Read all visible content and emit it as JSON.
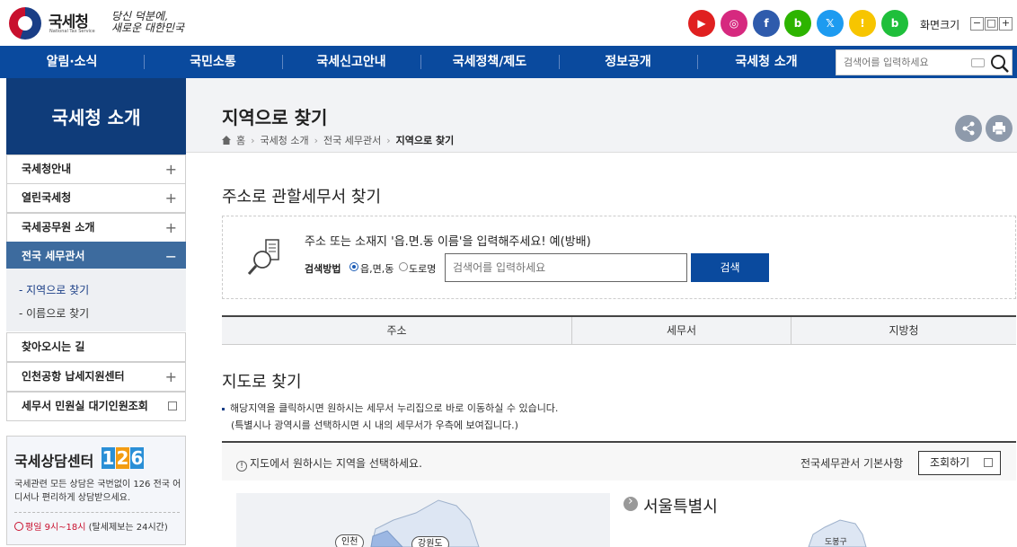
{
  "header": {
    "brand": "국세청",
    "brand_sub": "National Tax Service",
    "slogan_line1": "당신 덕분에,",
    "slogan_line2": "새로운 대한민국",
    "sns": [
      {
        "name": "youtube-icon",
        "glyph": "▶",
        "color": "#e02020"
      },
      {
        "name": "instagram-icon",
        "glyph": "◎",
        "color": "#d6297f"
      },
      {
        "name": "facebook-icon",
        "glyph": "f",
        "color": "#2f5bac"
      },
      {
        "name": "blog-icon",
        "glyph": "b",
        "color": "#2db400"
      },
      {
        "name": "x-icon",
        "glyph": "𝕏",
        "color": "#1d9bf0"
      },
      {
        "name": "kakao-story-icon",
        "glyph": "!",
        "color": "#f7c500"
      },
      {
        "name": "band-icon",
        "glyph": "b",
        "color": "#1fbf3b"
      }
    ],
    "font_size_label": "화면크기",
    "font_size_buttons": [
      "−",
      "□",
      "+"
    ]
  },
  "gnb": {
    "items": [
      "알림·소식",
      "국민소통",
      "국세신고안내",
      "국세정책/제도",
      "정보공개",
      "국세청 소개"
    ],
    "search_placeholder": "검색어를 입력하세요"
  },
  "sidebar": {
    "title": "국세청 소개",
    "items": [
      {
        "label": "국세청안내",
        "icon": "+"
      },
      {
        "label": "열린국세청",
        "icon": "+"
      },
      {
        "label": "국세공무원 소개",
        "icon": "+"
      },
      {
        "label": "전국 세무관서",
        "icon": "−"
      },
      {
        "label": "찾아오시는 길",
        "icon": ""
      },
      {
        "label": "인천공항 납세지원센터",
        "icon": "+"
      },
      {
        "label": "세무서 민원실 대기인원조회",
        "icon": "ext"
      }
    ],
    "sub_items": [
      "- 지역으로 찾기",
      "- 이름으로 찾기"
    ],
    "consult": {
      "title": "국세상담센터",
      "number": [
        "1",
        "2",
        "6"
      ],
      "desc": "국세관련 모든 상담은 국번없이 126 전국 어디서나 편리하게 상담받으세요.",
      "time_red": "평일 9시~18시",
      "time_rest": "(탈세제보는 24시간)"
    }
  },
  "main": {
    "title": "지역으로 찾기",
    "breadcrumb": [
      "홈",
      "국세청 소개",
      "전국 세무관서",
      "지역으로 찾기"
    ],
    "address_section": {
      "title": "주소로 관할세무서 찾기",
      "message": "주소 또는 소재지 '읍.면.동 이름'을 입력해주세요! 예(방배)",
      "method_label": "검색방법",
      "options": [
        "읍,면,동",
        "도로명"
      ],
      "input_placeholder": "검색어를 입력하세요",
      "search_button": "검색"
    },
    "result_headers": [
      "주소",
      "세무서",
      "지방청"
    ],
    "map_section": {
      "title": "지도로 찾기",
      "desc1": "해당지역을 클릭하시면 원하시는 세무서 누리집으로 바로 이동하실 수 있습니다.",
      "desc2": "(특별시나 광역시를 선택하시면 시 내의 세무서가 우측에 보여집니다.)",
      "bar_message": "지도에서 원하시는 지역을 선택하세요.",
      "basic_label": "전국세무관서 기본사항",
      "view_button": "조회하기",
      "map_labels": [
        "인천",
        "강원도"
      ],
      "region_title": "서울특별시",
      "gu_label": "도봉구"
    }
  }
}
